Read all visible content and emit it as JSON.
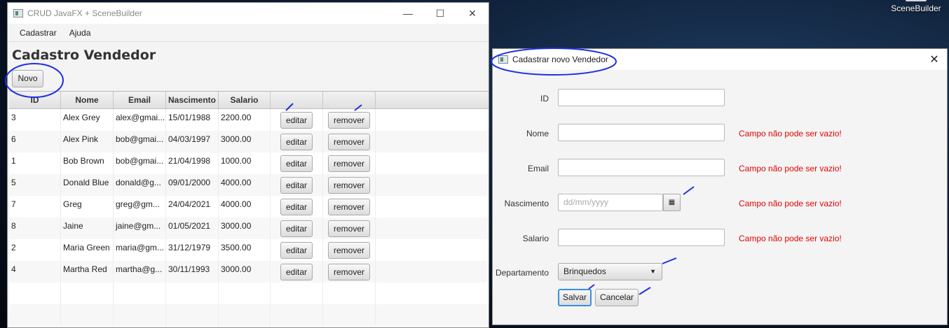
{
  "desktop": {
    "app_label": "SceneBuilder"
  },
  "main_window": {
    "title": "CRUD JavaFX + SceneBuilder",
    "controls": {
      "minimize": "—",
      "maximize": "☐",
      "close": "✕"
    },
    "menu": [
      "Cadastrar",
      "Ajuda"
    ],
    "heading": "Cadastro Vendedor",
    "new_button": "Novo",
    "table": {
      "columns": [
        "ID",
        "Nome",
        "Email",
        "Nascimento",
        "Salario",
        "",
        ""
      ],
      "rows": [
        {
          "id": "3",
          "nome": "Alex Grey",
          "email": "alex@gmai...",
          "nascimento": "15/01/1988",
          "salario": "2200.00"
        },
        {
          "id": "6",
          "nome": "Alex Pink",
          "email": "bob@gmai...",
          "nascimento": "04/03/1997",
          "salario": "3000.00"
        },
        {
          "id": "1",
          "nome": "Bob Brown",
          "email": "bob@gmai...",
          "nascimento": "21/04/1998",
          "salario": "1000.00"
        },
        {
          "id": "5",
          "nome": "Donald Blue",
          "email": "donald@g...",
          "nascimento": "09/01/2000",
          "salario": "4000.00"
        },
        {
          "id": "7",
          "nome": "Greg",
          "email": "greg@gm...",
          "nascimento": "24/04/2021",
          "salario": "4000.00"
        },
        {
          "id": "8",
          "nome": "Jaine",
          "email": "jaine@gm...",
          "nascimento": "01/05/2021",
          "salario": "3000.00"
        },
        {
          "id": "2",
          "nome": "Maria Green",
          "email": "maria@gm...",
          "nascimento": "31/12/1979",
          "salario": "3500.00"
        },
        {
          "id": "4",
          "nome": "Martha Red",
          "email": "martha@g...",
          "nascimento": "30/11/1993",
          "salario": "3000.00"
        }
      ],
      "edit_label": "editar",
      "remove_label": "remover"
    }
  },
  "dialog": {
    "title": "Cadastrar novo Vendedor",
    "close": "✕",
    "labels": {
      "id": "ID",
      "nome": "Nome",
      "email": "Email",
      "nascimento": "Nascimento",
      "salario": "Salario",
      "departamento": "Departamento"
    },
    "date_placeholder": "dd/mm/yyyy",
    "department_selected": "Brinquedos",
    "errors": {
      "nome": "Campo não pode ser vazio!",
      "email": "Campo não pode ser vazio!",
      "nascimento": "Campo não pode ser vazio!",
      "salario": "Campo não pode ser vazio!"
    },
    "save_button": "Salvar",
    "cancel_button": "Cancelar"
  },
  "colors": {
    "annotation": "#1f2fe0",
    "error": "#e40000"
  }
}
